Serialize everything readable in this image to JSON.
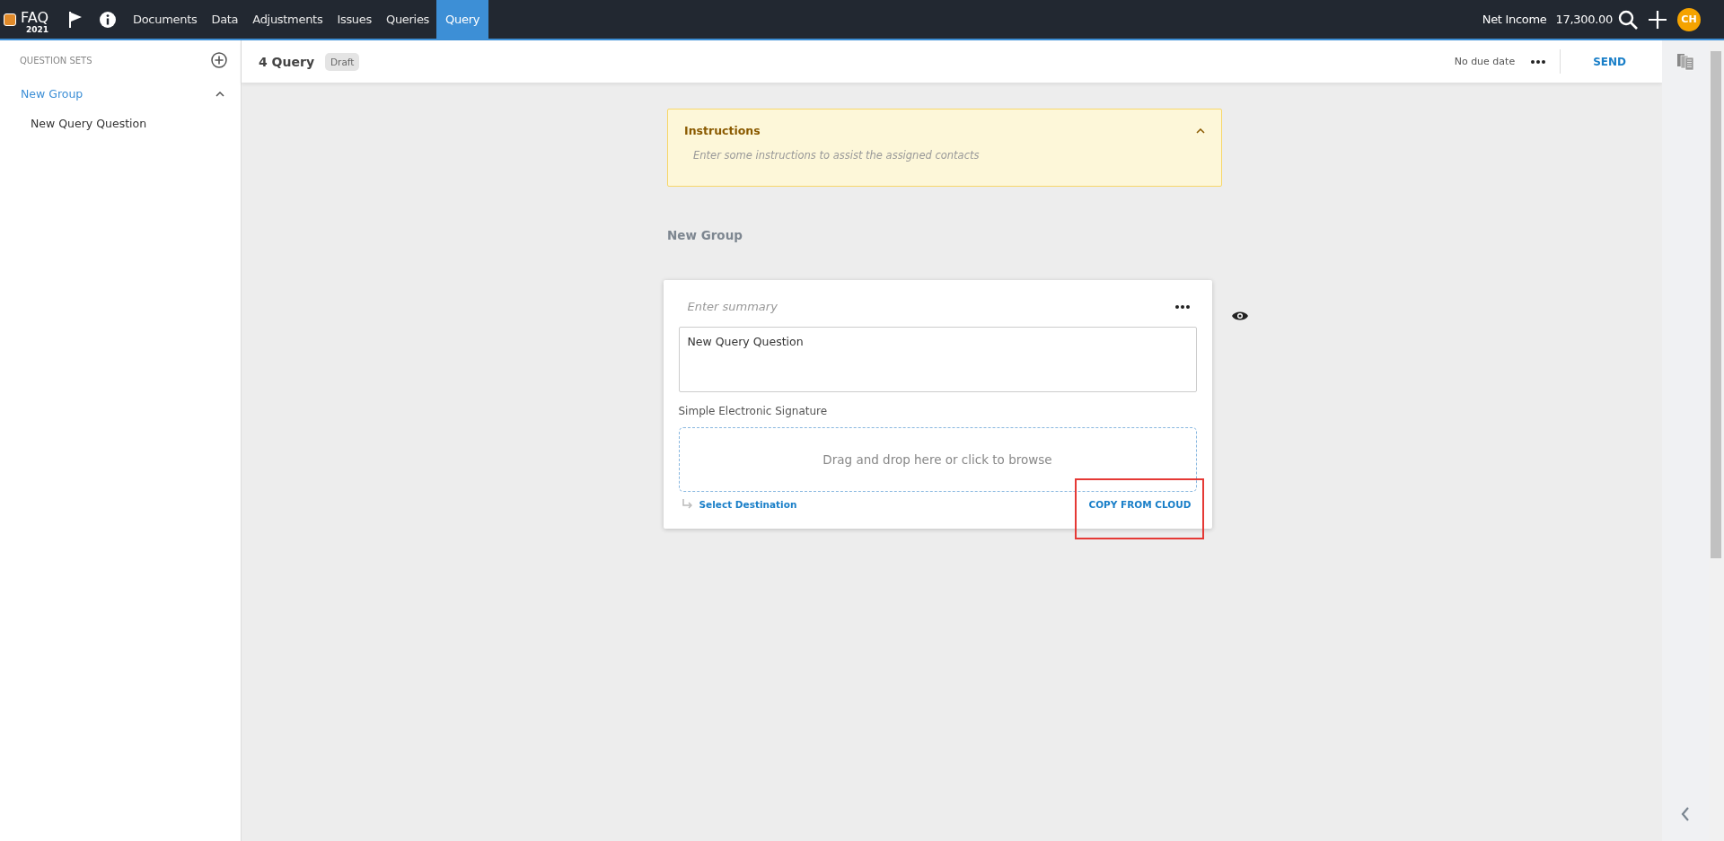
{
  "topbar": {
    "logo": "FAQ",
    "year": "2021",
    "nav": [
      {
        "label": "Documents",
        "selected": false
      },
      {
        "label": "Data",
        "selected": false
      },
      {
        "label": "Adjustments",
        "selected": false
      },
      {
        "label": "Issues",
        "selected": false
      },
      {
        "label": "Queries",
        "selected": false
      },
      {
        "label": "Query",
        "selected": true
      }
    ],
    "metric_label": "Net Income",
    "metric_value": "17,300.00",
    "avatar": "CH"
  },
  "sidebar": {
    "title": "QUESTION SETS",
    "items": [
      {
        "label": "New Group",
        "expanded": true,
        "children": [
          {
            "label": "New Query Question"
          }
        ]
      }
    ]
  },
  "header": {
    "title": "4 Query",
    "status": "Draft",
    "due": "No due date",
    "send": "SEND"
  },
  "instructions": {
    "title": "Instructions",
    "expanded": true,
    "placeholder": "Enter some instructions to assist the assigned contacts"
  },
  "group_title": "New Group",
  "question": {
    "summary_placeholder": "Enter summary",
    "text": "New Query Question",
    "signature_label": "Simple Electronic Signature",
    "dropzone": "Drag and drop here or click to browse",
    "destination": "Select Destination",
    "copy": {
      "label": "COPY FROM CLOUD",
      "highlighted": true
    }
  }
}
